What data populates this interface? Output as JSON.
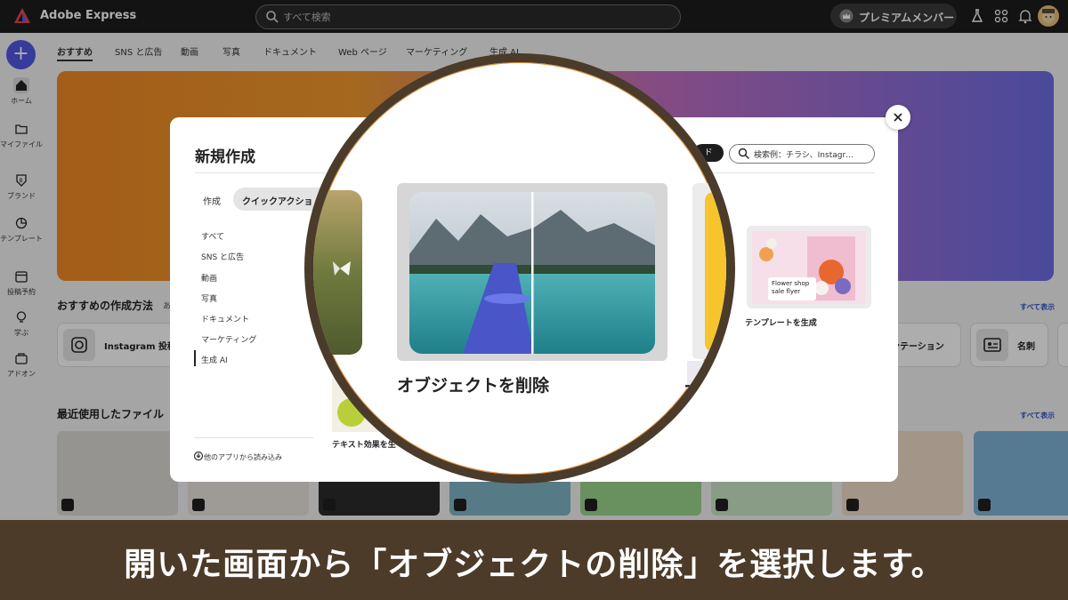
{
  "app": {
    "brand": "Adobe Express",
    "search_placeholder": "すべて検索",
    "premium_label": "プレミアムメンバー"
  },
  "sidebar": {
    "create_label": "+",
    "items": [
      {
        "label": "ホーム"
      },
      {
        "label": "マイファイル"
      },
      {
        "label": "ブランド"
      },
      {
        "label": "テンプレート"
      },
      {
        "label": "投稿予約"
      },
      {
        "label": "学ぶ"
      },
      {
        "label": "アドオン"
      }
    ]
  },
  "tabs": [
    "おすすめ",
    "SNS と広告",
    "動画",
    "写真",
    "ドキュメント",
    "Web ページ",
    "マーケティング",
    "生成 AI"
  ],
  "recommended": {
    "title": "おすすめの作成方法",
    "title_suffix": "あ",
    "see_all": "すべて表示",
    "cards": [
      {
        "label": "Instagram 投稿"
      },
      {
        "label": "ンテーション"
      },
      {
        "label": "名刺"
      }
    ]
  },
  "recent": {
    "title": "最近使用したファイル",
    "see_all": "すべて表示"
  },
  "modal": {
    "title": "新規作成",
    "pill_label": "ド",
    "search_placeholder": "検索例：チラシ、Instagr…",
    "tab_create": "作成",
    "tab_quick": "クイックアクショ",
    "categories": [
      "すべて",
      "SNS と広告",
      "動画",
      "写真",
      "ドキュメント",
      "マーケティング",
      "生成 AI"
    ],
    "footer_link": "他のアプリから読み込み",
    "template_card": {
      "tag_text": "Flower shop sale flyer",
      "label": "テンプレートを生成"
    },
    "text_effect_label": "テキスト効果を生"
  },
  "magnifier": {
    "action_label": "オブジェクトを削除",
    "cut_letter": "ア"
  },
  "caption": "開いた画面から「オブジェクトの削除」を選択します。",
  "colors": {
    "accent": "#5258e4",
    "caption_bg": "#4d3b2a",
    "magnifier_ring": "#4a3b2b"
  }
}
